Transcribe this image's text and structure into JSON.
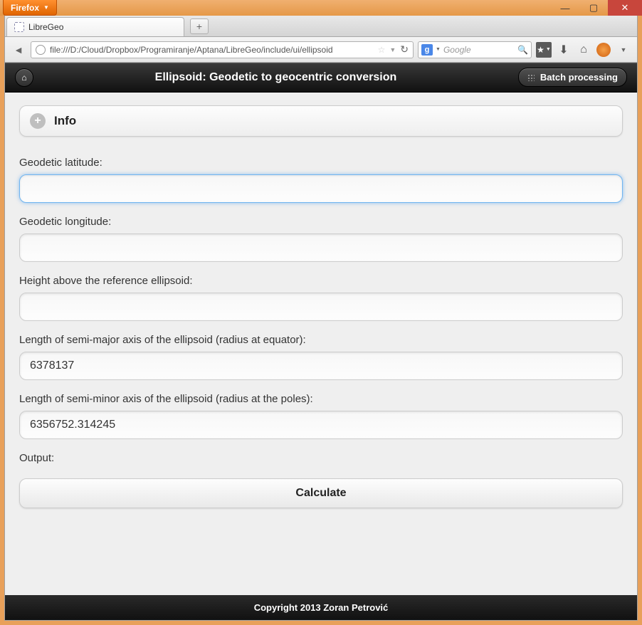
{
  "browser": {
    "name": "Firefox",
    "tab_title": "LibreGeo",
    "url": "file:///D:/Cloud/Dropbox/Programiranje/Aptana/LibreGeo/include/ui/ellipsoid",
    "search_placeholder": "Google",
    "search_engine_letter": "g"
  },
  "header": {
    "title": "Ellipsoid: Geodetic to geocentric conversion",
    "batch_label": "Batch processing"
  },
  "info": {
    "label": "Info"
  },
  "fields": {
    "lat": {
      "label": "Geodetic latitude:",
      "value": ""
    },
    "lon": {
      "label": "Geodetic longitude:",
      "value": ""
    },
    "height": {
      "label": "Height above the reference ellipsoid:",
      "value": ""
    },
    "semi_major": {
      "label": "Length of semi-major axis of the ellipsoid (radius at equator):",
      "value": "6378137"
    },
    "semi_minor": {
      "label": "Length of semi-minor axis of the ellipsoid (radius at the poles):",
      "value": "6356752.314245"
    }
  },
  "output_label": "Output:",
  "calculate_label": "Calculate",
  "footer": "Copyright 2013 Zoran Petrović"
}
